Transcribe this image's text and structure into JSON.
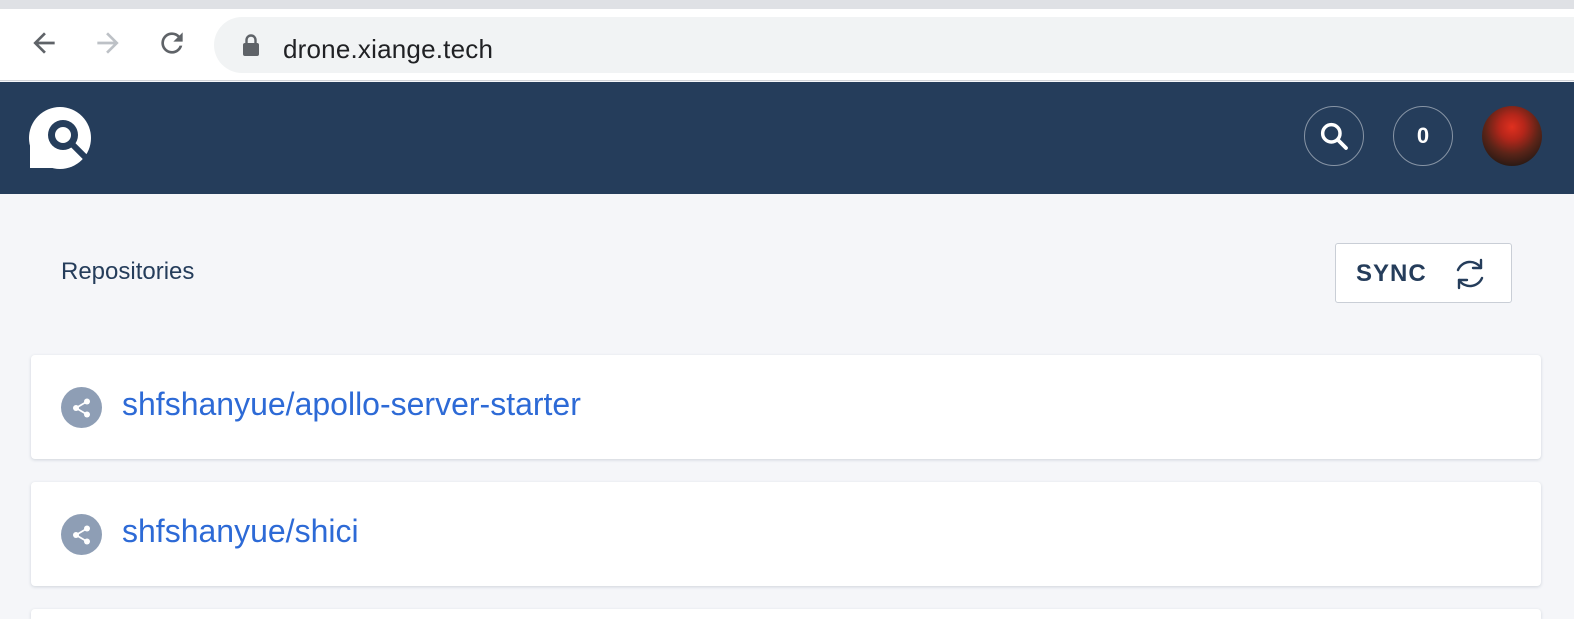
{
  "browser": {
    "url": "drone.xiange.tech",
    "back_icon": "arrow-left-icon",
    "forward_icon": "arrow-right-icon",
    "reload_icon": "reload-icon",
    "lock_icon": "lock-icon"
  },
  "header": {
    "logo_icon": "drone-logo-icon",
    "search_icon": "search-icon",
    "count": "0",
    "avatar": "user-avatar",
    "background_color": "#253d5b"
  },
  "main": {
    "heading": "Repositories",
    "sync_label": "SYNC",
    "sync_icon": "refresh-icon",
    "repositories": [
      {
        "name": "shfshanyue/apollo-server-starter",
        "icon": "share-icon"
      },
      {
        "name": "shfshanyue/shici",
        "icon": "share-icon"
      }
    ]
  },
  "colors": {
    "link": "#2d6ad6",
    "text": "#253d5b",
    "page_background": "#f5f6f9"
  }
}
